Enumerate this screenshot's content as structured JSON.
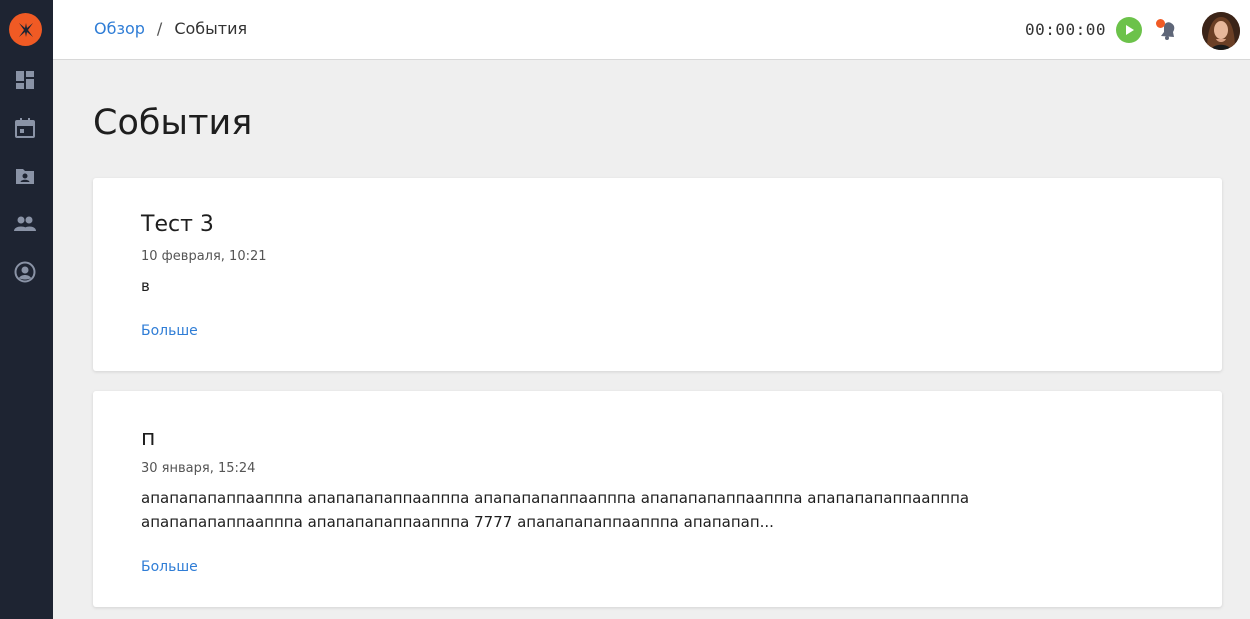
{
  "breadcrumb": {
    "home": "Обзор",
    "separator": "/",
    "current": "События"
  },
  "header": {
    "timer": "00:00:00"
  },
  "sidebar": {
    "items": [
      {
        "icon": "dashboard-icon"
      },
      {
        "icon": "calendar-icon"
      },
      {
        "icon": "contacts-folder-icon"
      },
      {
        "icon": "people-icon"
      },
      {
        "icon": "account-circle-icon"
      }
    ]
  },
  "page": {
    "title": "События"
  },
  "events": [
    {
      "title": "Тест 3",
      "date": "10 февраля, 10:21",
      "body": "в",
      "more": "Больше"
    },
    {
      "title": "п",
      "date": "30 января, 15:24",
      "body": "апапапапаппаапппа апапапапаппаапппа апапапапаппаапппа апапапапаппаапппа апапапапаппаапппа апапапапаппаапппа апапапапаппаапппа 7777 апапапапаппаапппа апапапап...",
      "more": "Больше"
    }
  ],
  "colors": {
    "accent": "#f05a24",
    "link": "#2f7dd6",
    "play": "#6cc24a",
    "sidebar": "#1e2432"
  }
}
